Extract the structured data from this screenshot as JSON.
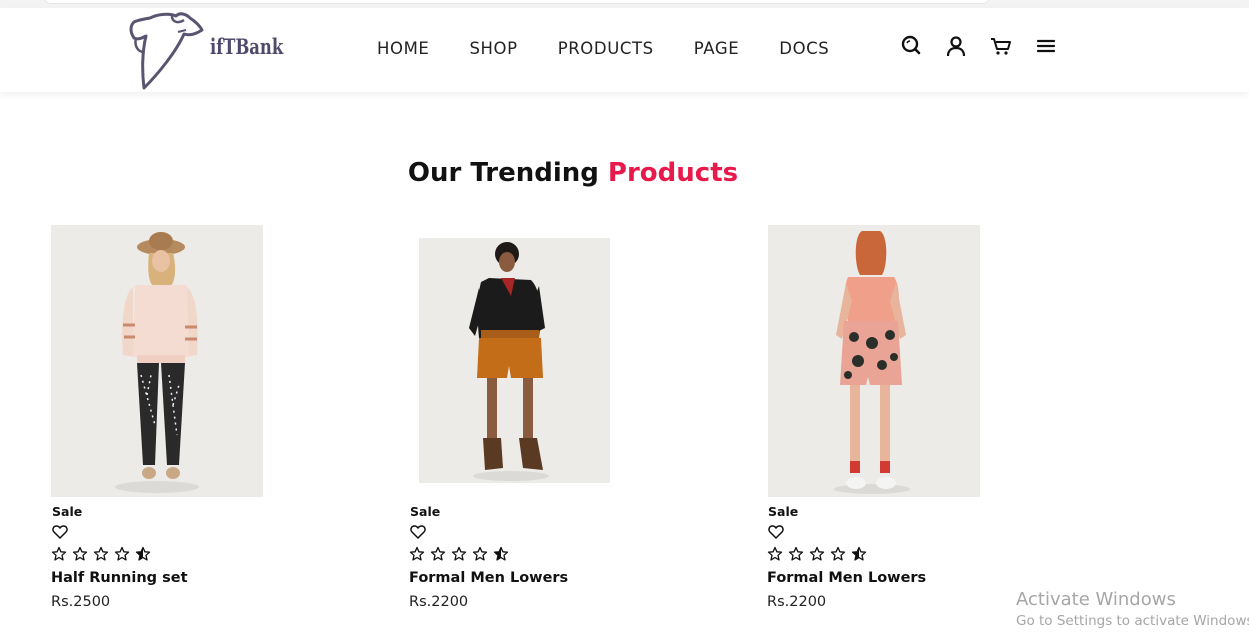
{
  "brand": {
    "logo_text": "ifTBank"
  },
  "nav": {
    "items": [
      "HOME",
      "SHOP",
      "PRODUCTS",
      "PAGE",
      "DOCS"
    ]
  },
  "header_icons": [
    "search-icon",
    "user-icon",
    "cart-icon",
    "menu-icon"
  ],
  "section": {
    "title_main": "Our Trending ",
    "title_accent": "Products",
    "accent_color": "#e8194b"
  },
  "products": [
    {
      "badge": "Sale",
      "name": "Half Running set",
      "price": "Rs.2500",
      "rating": 4.5
    },
    {
      "badge": "Sale",
      "name": "Formal Men Lowers",
      "price": "Rs.2200",
      "rating": 4.5
    },
    {
      "badge": "Sale",
      "name": "Formal Men Lowers",
      "price": "Rs.2200",
      "rating": 4.5
    }
  ],
  "watermark": {
    "line1": "Activate Windows",
    "line2": "Go to Settings to activate Windows."
  }
}
